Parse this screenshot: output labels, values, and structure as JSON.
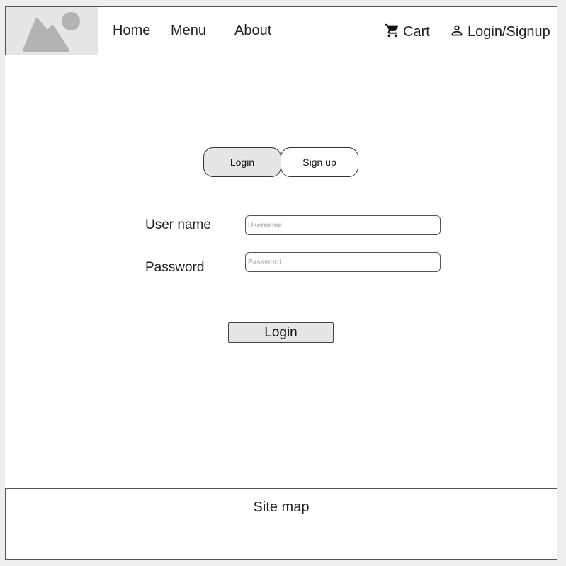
{
  "header": {
    "logo_icon": "image-placeholder-icon",
    "nav": [
      {
        "label": "Home"
      },
      {
        "label": "Menu"
      },
      {
        "label": "About"
      }
    ],
    "cart": {
      "label": "Cart",
      "icon": "cart-icon"
    },
    "account": {
      "label": "Login/Signup",
      "icon": "user-icon"
    }
  },
  "auth_tabs": {
    "login": "Login",
    "signup": "Sign up",
    "active": "login"
  },
  "form": {
    "username": {
      "label": "User name",
      "placeholder": "Username",
      "value": ""
    },
    "password": {
      "label": "Password",
      "placeholder": "Password",
      "value": ""
    },
    "submit_label": "Login"
  },
  "footer": {
    "title": "Site map"
  },
  "colors": {
    "frame_bg": "#eeeeee",
    "active_fill": "#e6e6e6",
    "border": "#555555",
    "placeholder": "#b8b8b8"
  }
}
